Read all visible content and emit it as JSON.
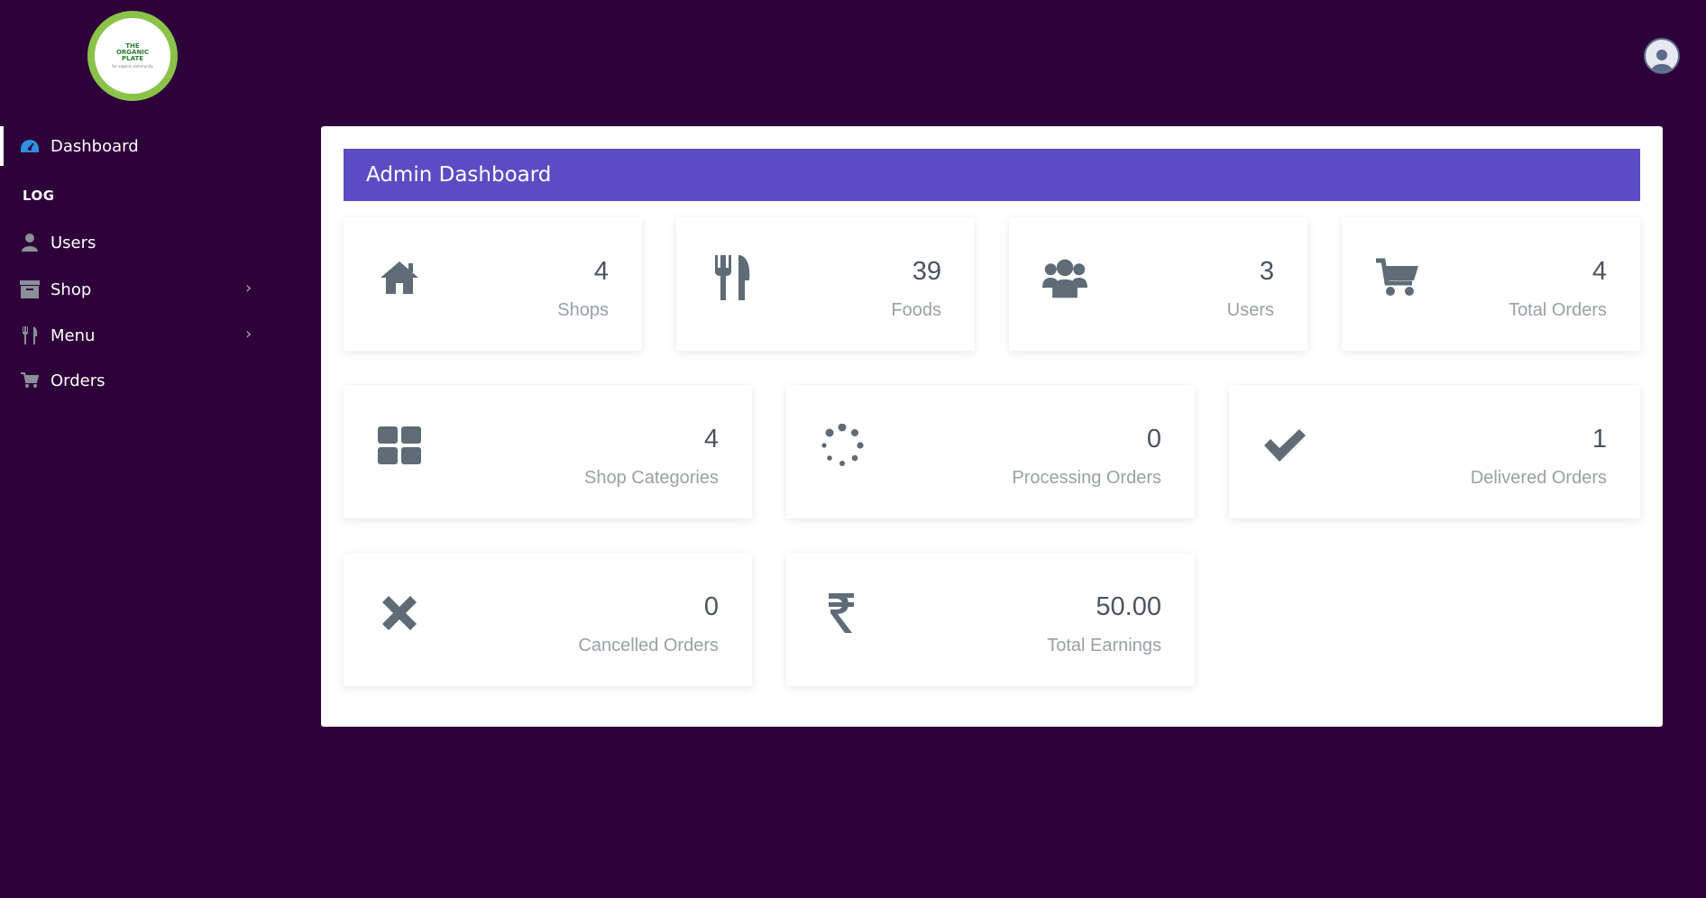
{
  "brand": {
    "logo_text": "THE ORGANIC PLATE",
    "logo_sub": "for organic community"
  },
  "sidebar": {
    "items": [
      {
        "label": "Dashboard",
        "icon": "dashboard-icon",
        "active": true
      },
      {
        "section": "LOG"
      },
      {
        "label": "Users",
        "icon": "user-icon"
      },
      {
        "label": "Shop",
        "icon": "archive-icon",
        "has_submenu": true
      },
      {
        "label": "Menu",
        "icon": "utensils-icon",
        "has_submenu": true
      },
      {
        "label": "Orders",
        "icon": "cart-icon"
      }
    ]
  },
  "header": {
    "avatar_icon": "user-avatar-icon"
  },
  "main": {
    "title": "Admin Dashboard",
    "cards": [
      {
        "value": "4",
        "label": "Shops",
        "icon": "home-icon"
      },
      {
        "value": "39",
        "label": "Foods",
        "icon": "utensils-icon"
      },
      {
        "value": "3",
        "label": "Users",
        "icon": "users-icon"
      },
      {
        "value": "4",
        "label": "Total Orders",
        "icon": "cart-icon"
      },
      {
        "value": "4",
        "label": "Shop Categories",
        "icon": "grid-icon"
      },
      {
        "value": "0",
        "label": "Processing Orders",
        "icon": "spinner-icon"
      },
      {
        "value": "1",
        "label": "Delivered Orders",
        "icon": "check-icon"
      },
      {
        "value": "0",
        "label": "Cancelled Orders",
        "icon": "times-icon"
      },
      {
        "value": "50.00",
        "label": "Total Earnings",
        "icon": "rupee-icon"
      }
    ]
  },
  "colors": {
    "background": "#2e003a",
    "header_bar": "#5b4cc4",
    "icon": "#5f6b76",
    "accent": "#2f8fe0",
    "logo_ring": "#8bc34a"
  }
}
